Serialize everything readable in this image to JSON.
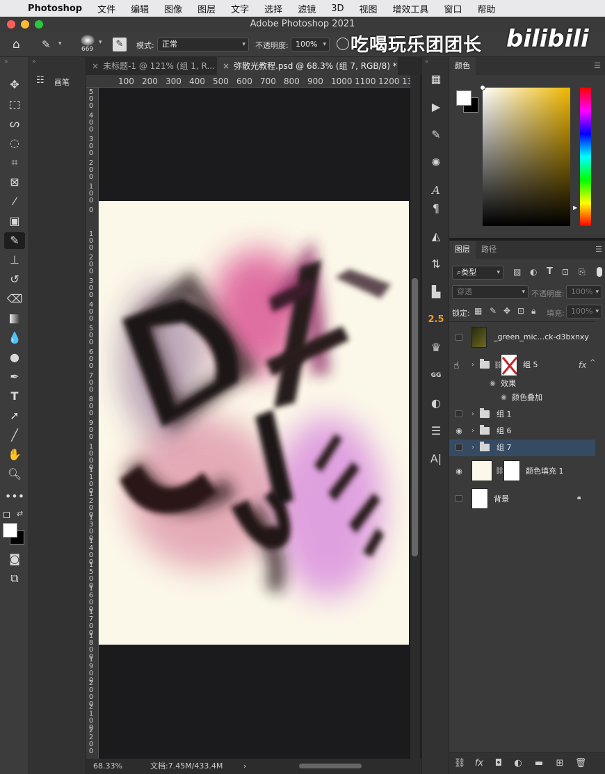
{
  "menubar": {
    "app_name": "Photoshop",
    "items": [
      "文件",
      "编辑",
      "图像",
      "图层",
      "文字",
      "选择",
      "滤镜",
      "3D",
      "视图",
      "增效工具",
      "窗口",
      "帮助"
    ]
  },
  "window": {
    "title": "Adobe Photoshop 2021"
  },
  "options_bar": {
    "brush_size": "669",
    "mode_label": "模式:",
    "mode_value": "正常",
    "opacity_label": "不透明度:",
    "opacity_value": "100%"
  },
  "watermark": {
    "text": "吃喝玩乐团团长",
    "logo": "bilibili"
  },
  "side_panel": {
    "brush_label": "画笔"
  },
  "tabs": [
    {
      "label": "未标题-1 @ 121% (组 1, R...",
      "close": "×"
    },
    {
      "label": "弥散光教程.psd @ 68.3% (组 7, RGB/8) *",
      "close": "×"
    }
  ],
  "ruler": {
    "h": [
      "100",
      "200",
      "300",
      "400",
      "500",
      "600",
      "700",
      "800",
      "900",
      "1000",
      "1100",
      "1200",
      "130"
    ],
    "v": [
      "5\n0\n0",
      "4\n0\n0",
      "3\n0\n0",
      "2\n0\n0",
      "1\n0\n0",
      "0",
      "1\n0\n0",
      "2\n0\n0",
      "3\n0\n0",
      "4\n0\n0",
      "5\n0\n0",
      "6\n0\n0",
      "7\n0\n0",
      "8\n0\n0",
      "9\n0\n0",
      "1\n0\n0\n0",
      "1\n1\n0\n0",
      "1\n2\n0\n0",
      "1\n3\n0\n0",
      "1\n4\n0\n0",
      "1\n5\n0\n0",
      "1\n6\n0\n0",
      "1\n7\n0\n0",
      "1\n8\n0\n0",
      "1\n9\n0\n0",
      "2\n0\n0\n0",
      "2\n1\n0\n0",
      "2\n2\n0\n0"
    ]
  },
  "status": {
    "zoom": "68.33%",
    "doc": "文档:7.45M/433.4M",
    "arrow": "›"
  },
  "strip_icons": {
    "two_five": "2.5",
    "gg": "GG"
  },
  "color_panel": {
    "tab": "颜色",
    "fg": "#ffffff",
    "bg": "#000000"
  },
  "layers_panel": {
    "tabs": [
      "图层",
      "路径"
    ],
    "filter_label": "类型",
    "blend_mode": "穿透",
    "opacity_label": "不透明度:",
    "opacity_value": "100%",
    "lock_label": "锁定:",
    "fill_label": "填充:",
    "fill_value": "100%",
    "layers": [
      {
        "name": "_green_mic...ck-d3bxnxy",
        "visible": false,
        "type": "smart-object"
      },
      {
        "name": "组 5",
        "visible": true,
        "type": "group",
        "fx": "fx"
      },
      {
        "name": "效果",
        "visible": true,
        "type": "effects"
      },
      {
        "name": "颜色叠加",
        "visible": true,
        "type": "effect"
      },
      {
        "name": "组 1",
        "visible": false,
        "type": "group"
      },
      {
        "name": "组 6",
        "visible": true,
        "type": "group"
      },
      {
        "name": "组 7",
        "visible": false,
        "type": "group",
        "selected": true
      },
      {
        "name": "颜色填充 1",
        "visible": true,
        "type": "fill"
      },
      {
        "name": "背景",
        "visible": false,
        "type": "background"
      }
    ]
  },
  "artwork_colors": {
    "cream": "#fcf8e9",
    "magenta": "#d0287a",
    "violet": "#c85ad8",
    "dark": "#2a1a1a"
  }
}
